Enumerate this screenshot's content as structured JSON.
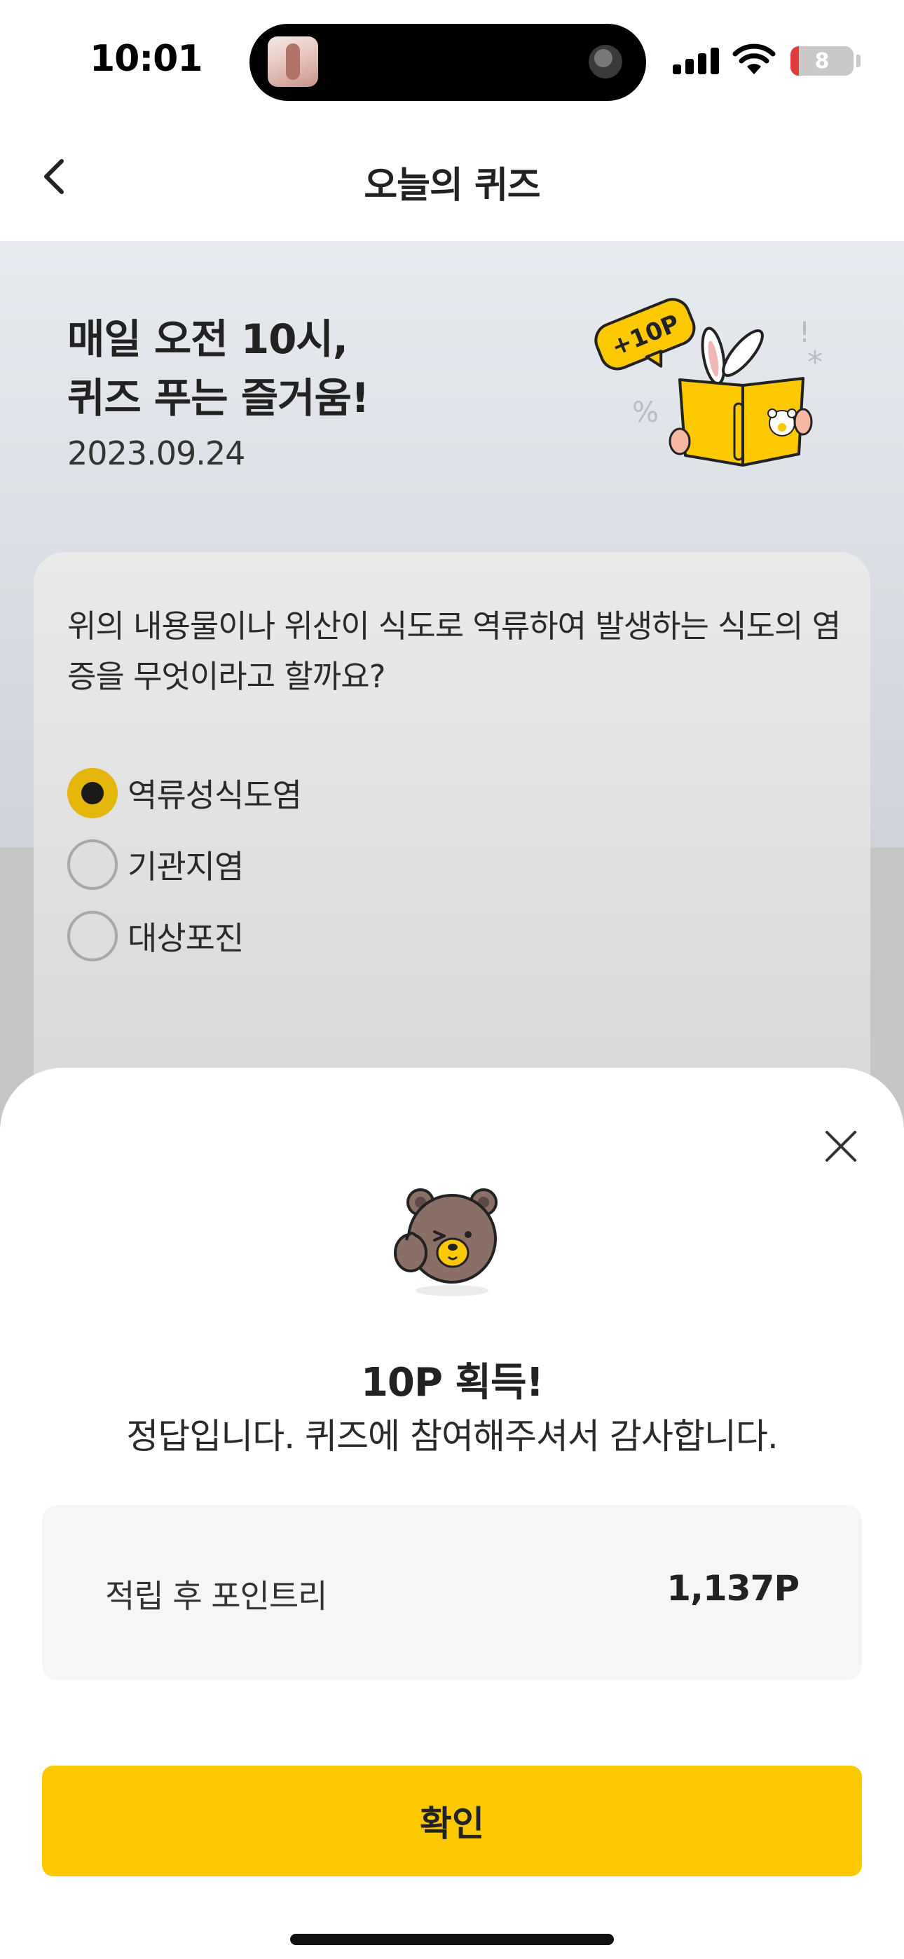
{
  "status_bar": {
    "time": "10:01",
    "battery": "8",
    "battery_color": "#e03c3c"
  },
  "nav": {
    "title": "오늘의 퀴즈",
    "back_icon": "chevron-left-icon"
  },
  "hero": {
    "headline_line1": "매일 오전 10시,",
    "headline_line2": "퀴즈 푸는 즐거움!",
    "date": "2023.09.24",
    "badge": "+10P"
  },
  "quiz": {
    "question": "위의 내용물이나 위산이 식도로 역류하여 발생하는 식도의 염증을 무엇이라고 할까요?",
    "options": [
      {
        "label": "역류성식도염",
        "selected": true
      },
      {
        "label": "기관지염",
        "selected": false
      },
      {
        "label": "대상포진",
        "selected": false
      }
    ]
  },
  "sheet": {
    "close_icon": "close-icon",
    "title": "10P 획득!",
    "message": "정답입니다. 퀴즈에 참여해주셔서 감사합니다.",
    "points_label": "적립 후 포인트리",
    "points_value": "1,137P",
    "confirm_label": "확인"
  },
  "colors": {
    "accent": "#fcc800",
    "radio_selected": "#e4b50a"
  }
}
